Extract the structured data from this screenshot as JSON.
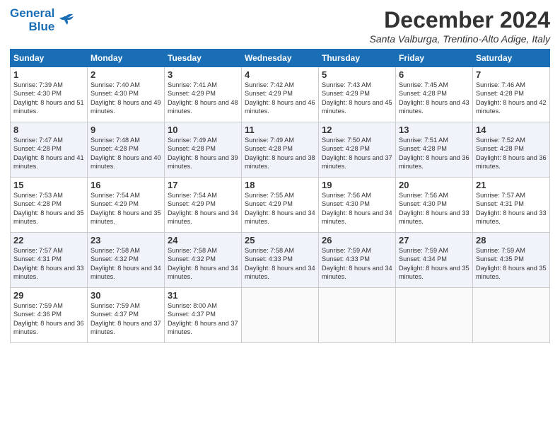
{
  "header": {
    "logo_line1": "General",
    "logo_line2": "Blue",
    "month_title": "December 2024",
    "location": "Santa Valburga, Trentino-Alto Adige, Italy"
  },
  "days_of_week": [
    "Sunday",
    "Monday",
    "Tuesday",
    "Wednesday",
    "Thursday",
    "Friday",
    "Saturday"
  ],
  "weeks": [
    [
      {
        "day": "1",
        "sunrise": "Sunrise: 7:39 AM",
        "sunset": "Sunset: 4:30 PM",
        "daylight": "Daylight: 8 hours and 51 minutes."
      },
      {
        "day": "2",
        "sunrise": "Sunrise: 7:40 AM",
        "sunset": "Sunset: 4:30 PM",
        "daylight": "Daylight: 8 hours and 49 minutes."
      },
      {
        "day": "3",
        "sunrise": "Sunrise: 7:41 AM",
        "sunset": "Sunset: 4:29 PM",
        "daylight": "Daylight: 8 hours and 48 minutes."
      },
      {
        "day": "4",
        "sunrise": "Sunrise: 7:42 AM",
        "sunset": "Sunset: 4:29 PM",
        "daylight": "Daylight: 8 hours and 46 minutes."
      },
      {
        "day": "5",
        "sunrise": "Sunrise: 7:43 AM",
        "sunset": "Sunset: 4:29 PM",
        "daylight": "Daylight: 8 hours and 45 minutes."
      },
      {
        "day": "6",
        "sunrise": "Sunrise: 7:45 AM",
        "sunset": "Sunset: 4:28 PM",
        "daylight": "Daylight: 8 hours and 43 minutes."
      },
      {
        "day": "7",
        "sunrise": "Sunrise: 7:46 AM",
        "sunset": "Sunset: 4:28 PM",
        "daylight": "Daylight: 8 hours and 42 minutes."
      }
    ],
    [
      {
        "day": "8",
        "sunrise": "Sunrise: 7:47 AM",
        "sunset": "Sunset: 4:28 PM",
        "daylight": "Daylight: 8 hours and 41 minutes."
      },
      {
        "day": "9",
        "sunrise": "Sunrise: 7:48 AM",
        "sunset": "Sunset: 4:28 PM",
        "daylight": "Daylight: 8 hours and 40 minutes."
      },
      {
        "day": "10",
        "sunrise": "Sunrise: 7:49 AM",
        "sunset": "Sunset: 4:28 PM",
        "daylight": "Daylight: 8 hours and 39 minutes."
      },
      {
        "day": "11",
        "sunrise": "Sunrise: 7:49 AM",
        "sunset": "Sunset: 4:28 PM",
        "daylight": "Daylight: 8 hours and 38 minutes."
      },
      {
        "day": "12",
        "sunrise": "Sunrise: 7:50 AM",
        "sunset": "Sunset: 4:28 PM",
        "daylight": "Daylight: 8 hours and 37 minutes."
      },
      {
        "day": "13",
        "sunrise": "Sunrise: 7:51 AM",
        "sunset": "Sunset: 4:28 PM",
        "daylight": "Daylight: 8 hours and 36 minutes."
      },
      {
        "day": "14",
        "sunrise": "Sunrise: 7:52 AM",
        "sunset": "Sunset: 4:28 PM",
        "daylight": "Daylight: 8 hours and 36 minutes."
      }
    ],
    [
      {
        "day": "15",
        "sunrise": "Sunrise: 7:53 AM",
        "sunset": "Sunset: 4:28 PM",
        "daylight": "Daylight: 8 hours and 35 minutes."
      },
      {
        "day": "16",
        "sunrise": "Sunrise: 7:54 AM",
        "sunset": "Sunset: 4:29 PM",
        "daylight": "Daylight: 8 hours and 35 minutes."
      },
      {
        "day": "17",
        "sunrise": "Sunrise: 7:54 AM",
        "sunset": "Sunset: 4:29 PM",
        "daylight": "Daylight: 8 hours and 34 minutes."
      },
      {
        "day": "18",
        "sunrise": "Sunrise: 7:55 AM",
        "sunset": "Sunset: 4:29 PM",
        "daylight": "Daylight: 8 hours and 34 minutes."
      },
      {
        "day": "19",
        "sunrise": "Sunrise: 7:56 AM",
        "sunset": "Sunset: 4:30 PM",
        "daylight": "Daylight: 8 hours and 34 minutes."
      },
      {
        "day": "20",
        "sunrise": "Sunrise: 7:56 AM",
        "sunset": "Sunset: 4:30 PM",
        "daylight": "Daylight: 8 hours and 33 minutes."
      },
      {
        "day": "21",
        "sunrise": "Sunrise: 7:57 AM",
        "sunset": "Sunset: 4:31 PM",
        "daylight": "Daylight: 8 hours and 33 minutes."
      }
    ],
    [
      {
        "day": "22",
        "sunrise": "Sunrise: 7:57 AM",
        "sunset": "Sunset: 4:31 PM",
        "daylight": "Daylight: 8 hours and 33 minutes."
      },
      {
        "day": "23",
        "sunrise": "Sunrise: 7:58 AM",
        "sunset": "Sunset: 4:32 PM",
        "daylight": "Daylight: 8 hours and 34 minutes."
      },
      {
        "day": "24",
        "sunrise": "Sunrise: 7:58 AM",
        "sunset": "Sunset: 4:32 PM",
        "daylight": "Daylight: 8 hours and 34 minutes."
      },
      {
        "day": "25",
        "sunrise": "Sunrise: 7:58 AM",
        "sunset": "Sunset: 4:33 PM",
        "daylight": "Daylight: 8 hours and 34 minutes."
      },
      {
        "day": "26",
        "sunrise": "Sunrise: 7:59 AM",
        "sunset": "Sunset: 4:33 PM",
        "daylight": "Daylight: 8 hours and 34 minutes."
      },
      {
        "day": "27",
        "sunrise": "Sunrise: 7:59 AM",
        "sunset": "Sunset: 4:34 PM",
        "daylight": "Daylight: 8 hours and 35 minutes."
      },
      {
        "day": "28",
        "sunrise": "Sunrise: 7:59 AM",
        "sunset": "Sunset: 4:35 PM",
        "daylight": "Daylight: 8 hours and 35 minutes."
      }
    ],
    [
      {
        "day": "29",
        "sunrise": "Sunrise: 7:59 AM",
        "sunset": "Sunset: 4:36 PM",
        "daylight": "Daylight: 8 hours and 36 minutes."
      },
      {
        "day": "30",
        "sunrise": "Sunrise: 7:59 AM",
        "sunset": "Sunset: 4:37 PM",
        "daylight": "Daylight: 8 hours and 37 minutes."
      },
      {
        "day": "31",
        "sunrise": "Sunrise: 8:00 AM",
        "sunset": "Sunset: 4:37 PM",
        "daylight": "Daylight: 8 hours and 37 minutes."
      },
      null,
      null,
      null,
      null
    ]
  ]
}
